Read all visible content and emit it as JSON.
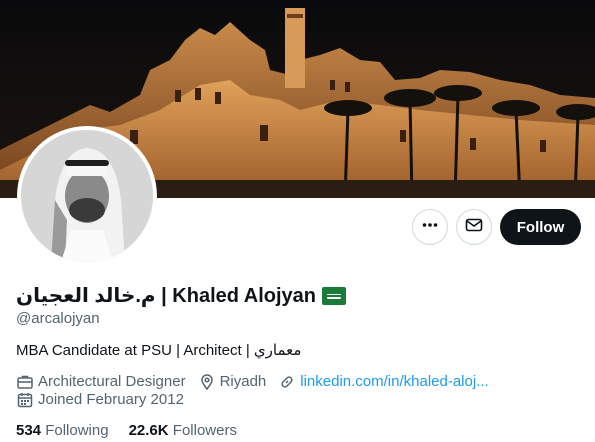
{
  "profile": {
    "display_name": "م.خالد العجيان | Khaled Alojyan",
    "handle": "@arcalojyan",
    "bio": "MBA Candidate at PSU | Architect | معماري",
    "profession": "Architectural Designer",
    "location": "Riyadh",
    "website": "linkedin.com/in/khaled-aloj...",
    "joined": "Joined February 2012"
  },
  "actions": {
    "follow_label": "Follow"
  },
  "stats": {
    "following_count": "534",
    "following_label": "Following",
    "followers_count": "22.6K",
    "followers_label": "Followers"
  },
  "colors": {
    "link": "#1d9bf0",
    "secondary_text": "#536471",
    "follow_bg": "#0f1419",
    "flag_green": "#1b7a3a"
  },
  "icons": [
    "more-icon",
    "mail-icon",
    "flag-icon",
    "briefcase-icon",
    "location-pin-icon",
    "link-icon",
    "calendar-icon"
  ]
}
